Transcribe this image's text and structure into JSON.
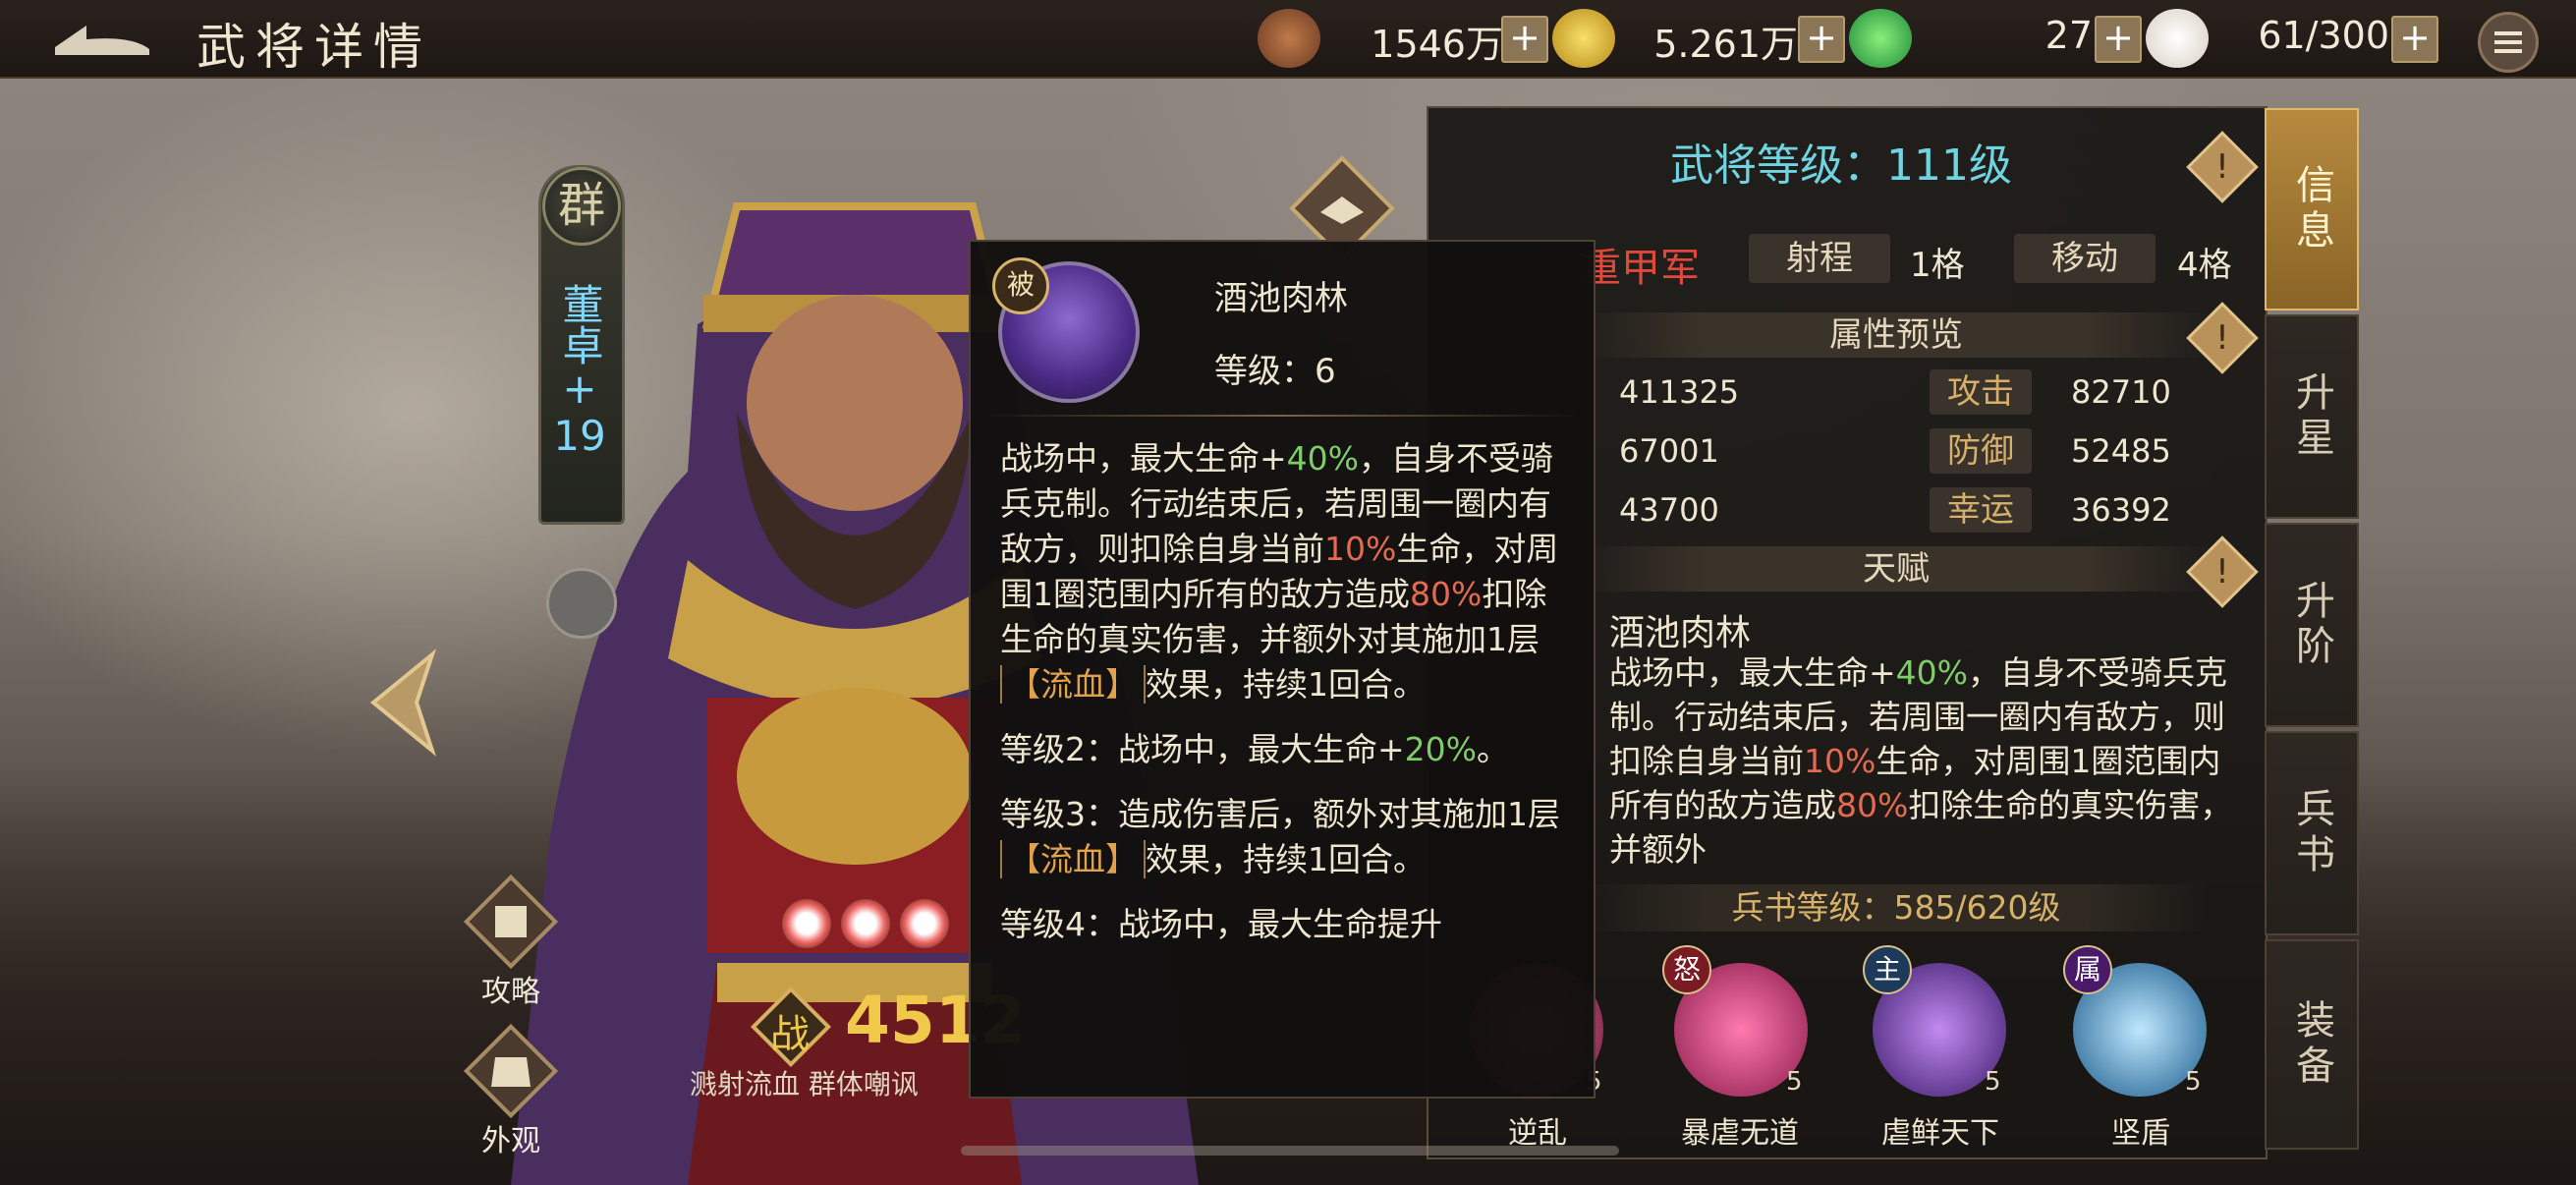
{
  "header": {
    "title": "武将详情",
    "resources": [
      {
        "icon": "copper-coins-icon",
        "value": "1546万"
      },
      {
        "icon": "gold-coin-icon",
        "value": "5.261万"
      },
      {
        "icon": "jade-icon",
        "value": "27"
      },
      {
        "icon": "steamed-bun-icon",
        "value": "61/300"
      }
    ],
    "plus": "+"
  },
  "hero": {
    "faction": "群",
    "name": "董卓",
    "plus_sign": "+",
    "rank": "19",
    "power_label": "战",
    "power_value": "4512",
    "traits": "溅射流血 群体嘲讽",
    "side_buttons": [
      {
        "name": "strategy",
        "label": "攻略"
      },
      {
        "name": "appearance",
        "label": "外观"
      }
    ]
  },
  "panel": {
    "level_text": "武将等级：111级",
    "unit_type": "重甲军",
    "range_label": "射程",
    "range_value": "1格",
    "move_label": "移动",
    "move_value": "4格",
    "attributes_header": "属性预览",
    "stats": [
      {
        "left_value": "411325",
        "key": "攻击",
        "value": "82710"
      },
      {
        "left_value": "67001",
        "key": "防御",
        "value": "52485"
      },
      {
        "left_value": "43700",
        "key": "幸运",
        "value": "36392"
      }
    ],
    "talent_header": "天赋",
    "talent_name": "酒池肉林",
    "talent_desc": {
      "p1": "战场中，最大生命+",
      "v1": "40%",
      "p2": "，自身不受骑兵克制。行动结束后，若周围一圈内有敌方，则扣除自身当前",
      "v2": "10%",
      "p3": "生命，对周围1圈范围内所有的敌方造成",
      "v3": "80%",
      "p4": "扣除生命的真实伤害，并额外"
    },
    "bingshu_level": "兵书等级：585/620级",
    "skills": [
      {
        "badge": "",
        "level": "5",
        "name": "逆乱"
      },
      {
        "badge": "怒",
        "level": "5",
        "name": "暴虐无道"
      },
      {
        "badge": "主",
        "level": "5",
        "name": "虐鲜天下"
      },
      {
        "badge": "属",
        "level": "5",
        "name": "坚盾"
      }
    ]
  },
  "tabs": [
    {
      "label": "信息",
      "active": true
    },
    {
      "label": "升星",
      "active": false
    },
    {
      "label": "升阶",
      "active": false
    },
    {
      "label": "兵书",
      "active": false
    },
    {
      "label": "装备",
      "active": false
    }
  ],
  "popup": {
    "badge": "被",
    "skill_name": "酒池肉林",
    "level": "等级：6",
    "para1": {
      "a": "战场中，最大生命+",
      "v1": "40%",
      "b": "，自身不受骑兵克制。行动结束后，若周围一圈内有敌方，则扣除自身当前",
      "v2": "10%",
      "c": "生命，对周围1圈范围内所有的敌方造成",
      "v3": "80%",
      "d": "扣除生命的真实伤害，并额外对其施加1层",
      "bleed": "【流血】",
      "e": "效果，持续1回合。"
    },
    "para2": {
      "a": "等级2：战场中，最大生命+",
      "v": "20%",
      "b": "。"
    },
    "para3": {
      "a": "等级3：造成伤害后，额外对其施加1层",
      "bleed": "【流血】",
      "b": "效果，持续1回合。"
    },
    "para4": "等级4：战场中，最大生命提升"
  },
  "colors": {
    "accent_cyan": "#6fd3e0",
    "gold": "#f0c84a",
    "green_value": "#7fcc6a",
    "red_value": "#e46a52",
    "bleed_tag": "#e2a24c"
  }
}
